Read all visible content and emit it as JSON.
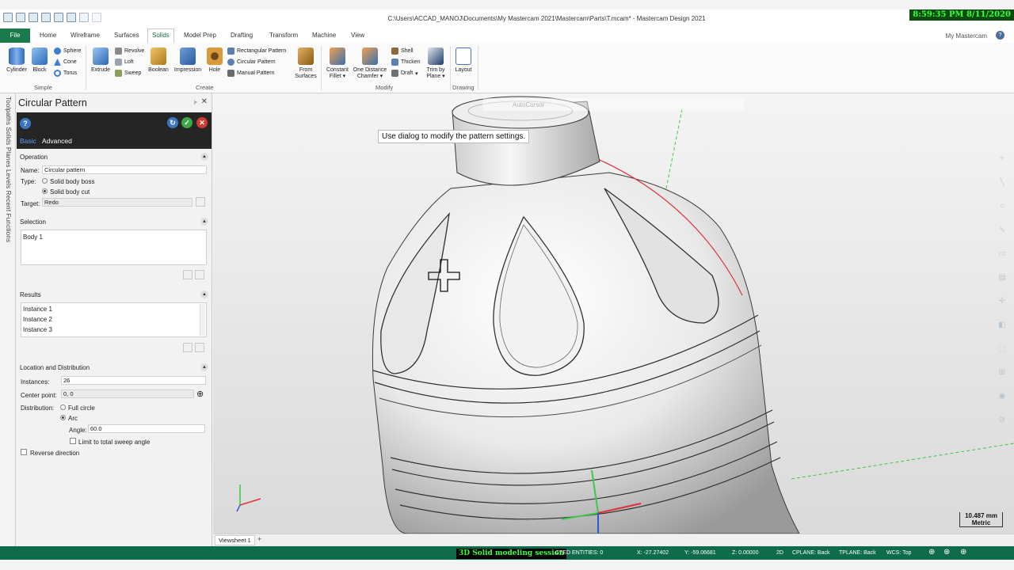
{
  "titlebar": {
    "title": "C:\\Users\\ACCAD_MANOJ\\Documents\\My Mastercam 2021\\Mastercam\\Parts\\T.mcam* - Mastercam Design 2021",
    "clock": "8:59:35 PM 8/11/2020"
  },
  "tabs": {
    "file": "File",
    "items": [
      "Home",
      "Wireframe",
      "Surfaces",
      "Solids",
      "Model Prep",
      "Drafting",
      "Transform",
      "Machine",
      "View"
    ],
    "my_mastercam": "My Mastercam"
  },
  "ribbon": {
    "cylinder": "Cylinder",
    "block": "Block",
    "sphere": "Sphere",
    "cone": "Cone",
    "torus": "Torus",
    "extrude": "Extrude",
    "revolve": "Revolve",
    "loft": "Loft",
    "sweep": "Sweep",
    "boolean": "Boolean",
    "impression": "Impression",
    "hole": "Hole",
    "rect_pattern": "Rectangular Pattern",
    "circ_pattern": "Circular Pattern",
    "manual_pattern": "Manual Pattern",
    "from_surfaces_1": "From",
    "from_surfaces_2": "Surfaces",
    "const_fillet_1": "Constant",
    "const_fillet_2": "Fillet",
    "one_dist_1": "One Distance",
    "one_dist_2": "Chamfer",
    "shell": "Shell",
    "thicken": "Thicken",
    "draft": "Draft",
    "trim_plane_1": "Trim by",
    "trim_plane_2": "Plane",
    "layout": "Layout",
    "groups": {
      "simple": "Simple",
      "create": "Create",
      "modify": "Modify",
      "drawing": "Drawing"
    }
  },
  "vtabs": "Toolpaths   Solids   Planes   Levels   Recent Functions",
  "panel": {
    "title": "Circular Pattern",
    "pin": "ₕ",
    "tabs": {
      "basic": "Basic",
      "advanced": "Advanced"
    },
    "operation": {
      "heading": "Operation",
      "name_label": "Name:",
      "name_value": "Circular pattern",
      "type_label": "Type:",
      "boss": "Solid body boss",
      "cut": "Solid body cut",
      "target_label": "Target:",
      "target_value": "Redo"
    },
    "selection": {
      "heading": "Selection",
      "item": "Body 1"
    },
    "results": {
      "heading": "Results",
      "items": [
        "Instance 1",
        "Instance 2",
        "Instance 3"
      ]
    },
    "location": {
      "heading": "Location and Distribution",
      "instances_label": "Instances:",
      "instances_value": "26",
      "center_label": "Center point:",
      "center_value": "0, 0",
      "distribution_label": "Distribution:",
      "full_circle": "Full circle",
      "arc": "Arc",
      "angle_label": "Angle:",
      "angle_value": "60.0",
      "limit": "Limit to total sweep angle"
    },
    "reverse": "Reverse direction"
  },
  "viewport": {
    "tooltip": "Use dialog to modify the pattern settings.",
    "autocursor": "AutoCursor",
    "scale_value": "10.487 mm",
    "scale_unit": "Metric"
  },
  "viewtabs": {
    "sheet": "Viewsheet 1",
    "add": "+"
  },
  "status": {
    "session": "3D Solid modeling session",
    "selected": "CTED ENTITIES: 0",
    "x": "X:   -27.27402",
    "y": "Y:   -59.06681",
    "z": "Z:   0.00000",
    "mode": "2D",
    "cplane": "CPLANE: Back",
    "tplane": "TPLANE: Back",
    "wcs": "WCS: Top"
  },
  "colors": {
    "accent": "#1a7a4c",
    "status": "#0e6c4a",
    "panel_head": "#252525"
  }
}
